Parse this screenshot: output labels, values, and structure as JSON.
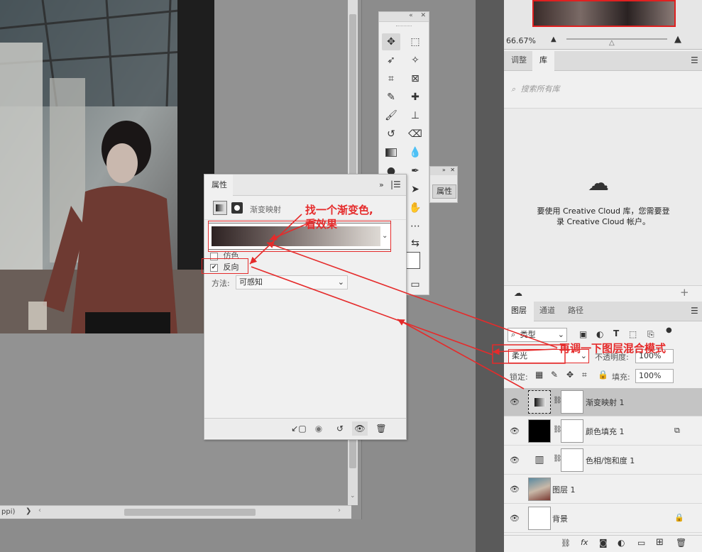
{
  "status_bar": {
    "left_text": "ppi)",
    "arrow": "❯",
    "scroll_left": "‹",
    "scroll_right": "›"
  },
  "toolbar": {
    "collapse": "«",
    "close": "✕"
  },
  "mini_panel": {
    "collapse": "»",
    "close": "✕",
    "label": "属性"
  },
  "properties": {
    "tab_label": "属性",
    "expand": "»",
    "adjustment_name": "渐变映射",
    "dither_label": "仿色",
    "reverse_label": "反向",
    "reverse_checked": "✔",
    "method_label": "方法:",
    "method_value": "可感知",
    "gradient_colors": [
      "#2d2222",
      "#6b5e5c",
      "#cfc9c4",
      "#ddd9d4"
    ]
  },
  "navigator": {
    "zoom": "66.67%"
  },
  "library_panel": {
    "tabs": [
      "调整",
      "库"
    ],
    "search_placeholder": "搜索所有库",
    "message_line1": "要使用 Creative Cloud 库，您需要登",
    "message_line2": "录 Creative Cloud 帐户。"
  },
  "layers_panel": {
    "tabs": [
      "图层",
      "通道",
      "路径"
    ],
    "filter_value": "类型",
    "blend_mode": "柔光",
    "opacity_label": "不透明度:",
    "opacity_value": "100%",
    "lock_label": "锁定:",
    "fill_label": "填充:",
    "fill_value": "100%",
    "layers": [
      {
        "name": "渐变映射 1",
        "selected": true
      },
      {
        "name": "颜色填充 1",
        "selected": false
      },
      {
        "name": "色相/饱和度 1",
        "selected": false
      },
      {
        "name": "图层 1",
        "selected": false
      },
      {
        "name": "背景",
        "selected": false
      }
    ]
  },
  "annotations": {
    "note1_line1": "找一个渐变色,",
    "note1_line2": "看效果",
    "note2": "再调一下图层混合模式",
    "color": "#e52b2b"
  }
}
